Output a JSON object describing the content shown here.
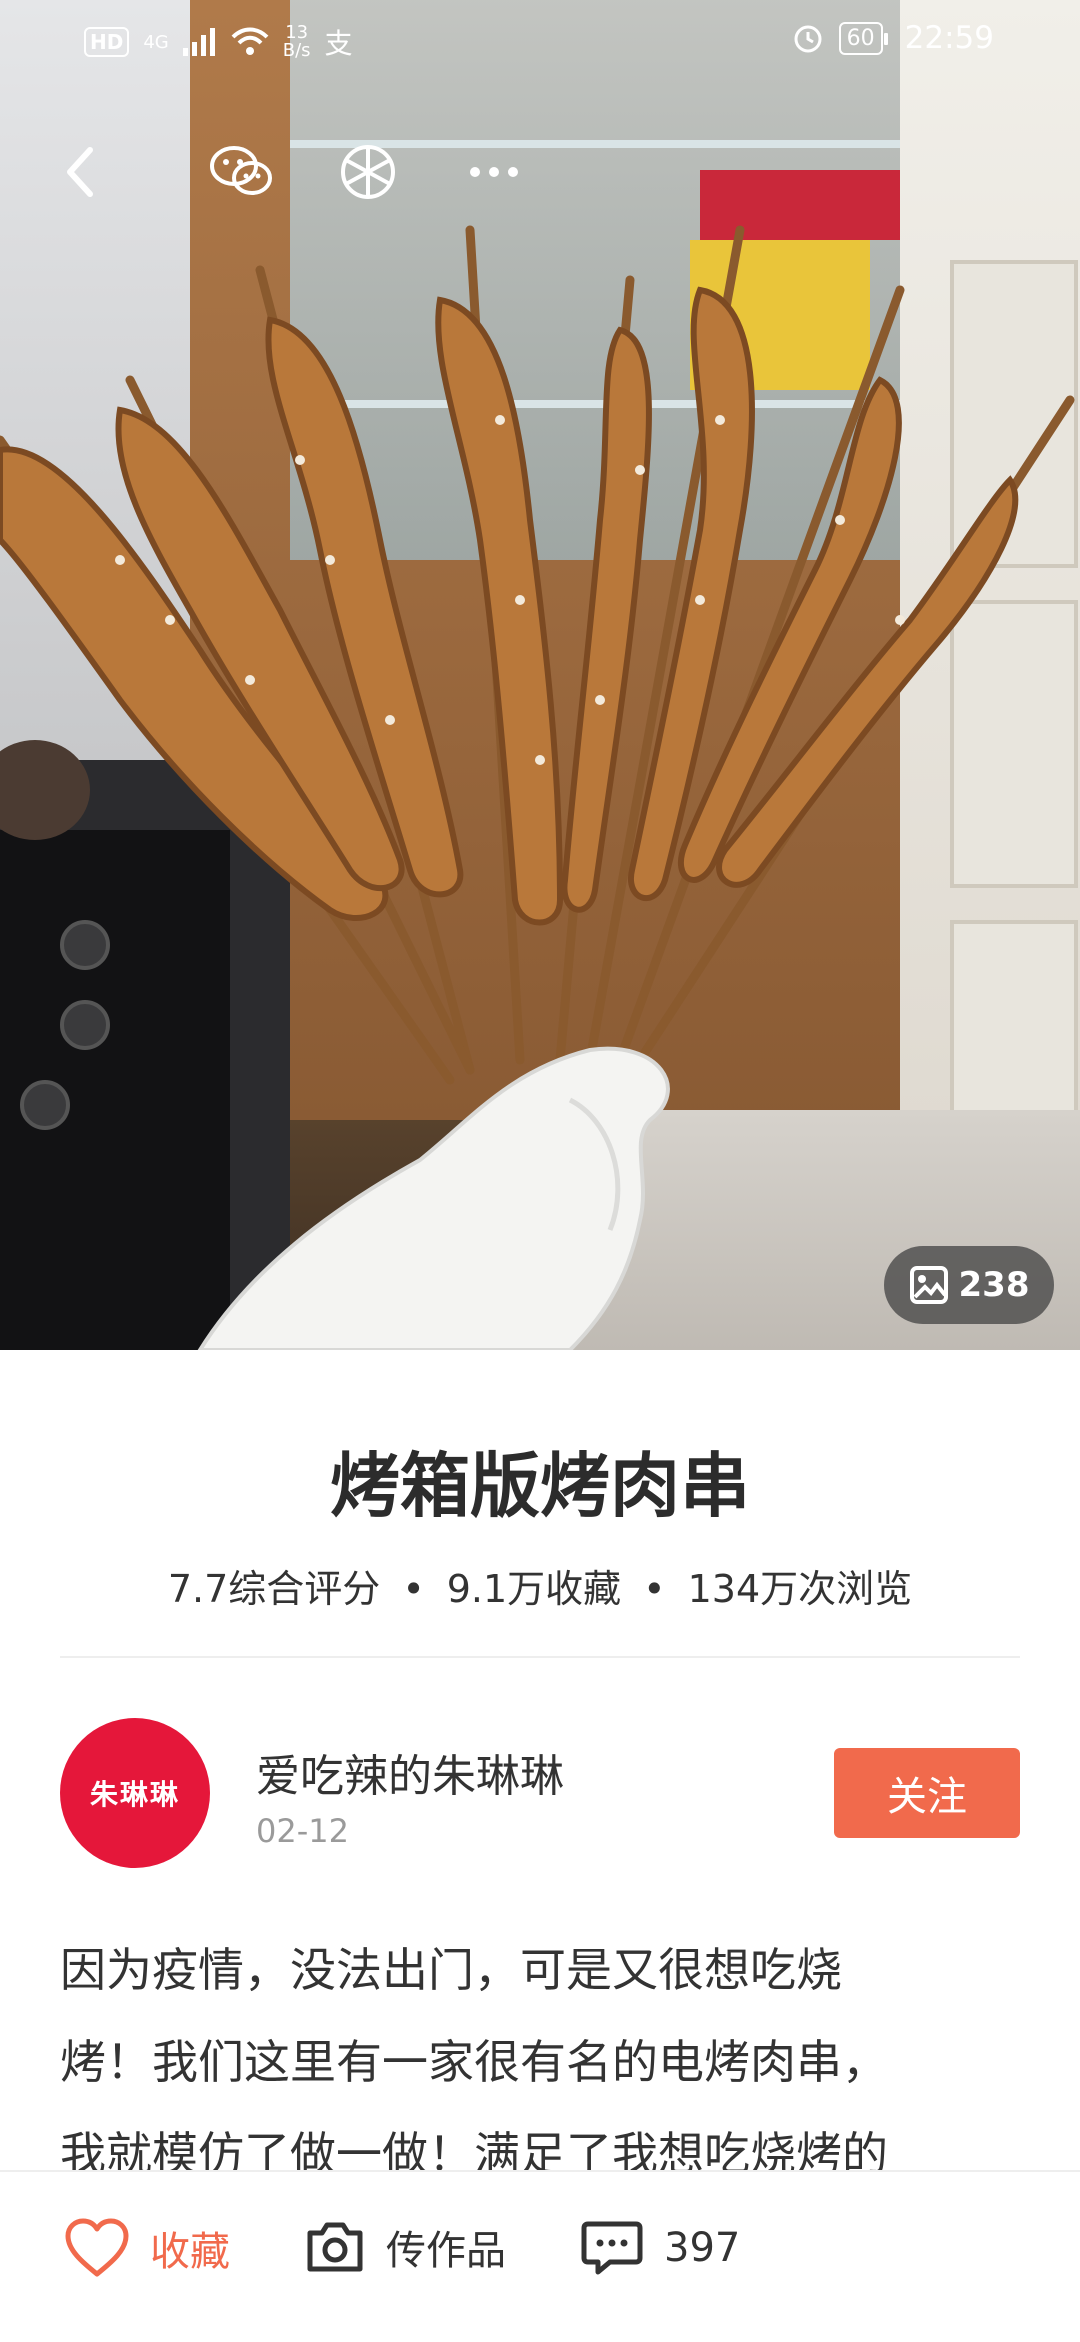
{
  "status_bar": {
    "hd": "HD",
    "network": "4G",
    "net_speed_value": "13",
    "net_speed_unit": "B/s",
    "battery": "60",
    "time": "22:59"
  },
  "top_actions": {
    "back_icon": "back-arrow-icon",
    "wechat_icon": "wechat-icon",
    "moments_icon": "wechat-moments-icon",
    "more_icon": "more-dots-icon"
  },
  "photo": {
    "count": "238"
  },
  "recipe": {
    "title": "烤箱版烤肉串",
    "rating": "7.7综合评分",
    "favorites": "9.1万收藏",
    "views": "134万次浏览"
  },
  "author": {
    "avatar_text": "朱琳琳",
    "name": "爱吃辣的朱琳琳",
    "date": "02-12",
    "follow_label": "关注"
  },
  "description": {
    "lines": [
      "因为疫情，没法出门，可是又很想吃烧",
      "烤！我们这里有一家很有名的电烤肉串，",
      "我就模仿了做一做！满足了我想吃烧烤的"
    ]
  },
  "bottom_bar": {
    "favorite_label": "收藏",
    "upload_label": "传作品",
    "comment_count": "397"
  },
  "colors": {
    "accent": "#f16a4c",
    "avatar_bg": "#e5173a"
  }
}
